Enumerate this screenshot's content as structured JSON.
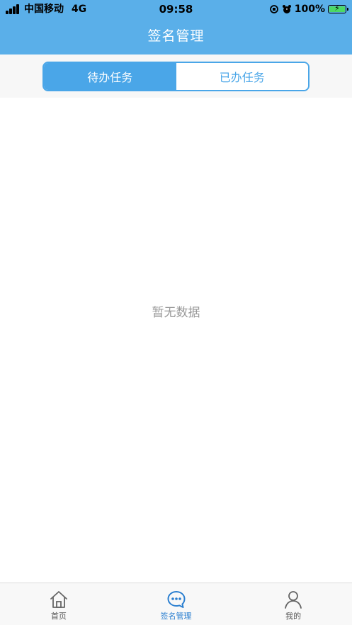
{
  "status_bar": {
    "carrier": "中国移动",
    "network": "4G",
    "time": "09:58",
    "battery": "100%",
    "battery_color": "#4cd964"
  },
  "nav": {
    "title": "签名管理",
    "background": "#5aafe9"
  },
  "tabs": [
    {
      "label": "待办任务",
      "active": true
    },
    {
      "label": "已办任务",
      "active": false
    }
  ],
  "content": {
    "empty_text": "暂无数据"
  },
  "bottom_nav": [
    {
      "label": "首页",
      "icon": "home-icon",
      "active": false
    },
    {
      "label": "签名管理",
      "icon": "chat-bubble-icon",
      "active": true
    },
    {
      "label": "我的",
      "icon": "user-icon",
      "active": false
    }
  ],
  "accent_color": "#4aa6e8"
}
